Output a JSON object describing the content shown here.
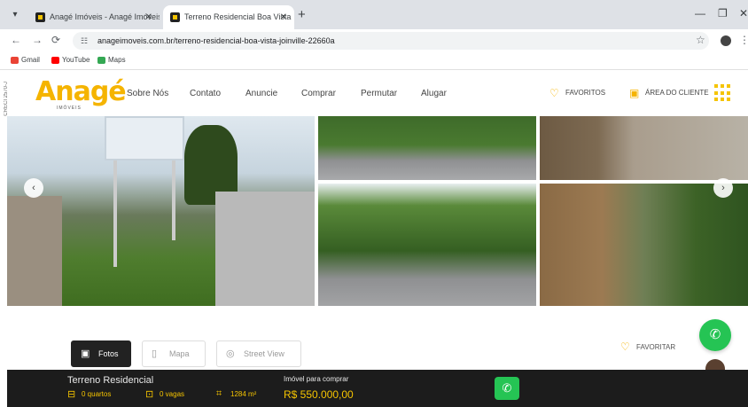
{
  "browser": {
    "tabs": [
      {
        "title": "Anagé Imóveis - Anagé Imóveis"
      },
      {
        "title": "Terreno Residencial Boa Vista"
      }
    ],
    "url": "anageimoveis.com.br/terreno-residencial-boa-vista-joinville-22660a",
    "bookmarks": [
      {
        "label": "Gmail",
        "color": "#ea4335"
      },
      {
        "label": "YouTube",
        "color": "#ff0000"
      },
      {
        "label": "Maps",
        "color": "#34a853"
      }
    ]
  },
  "header": {
    "side_label": "CRECI 2570-J",
    "logo": "Anagé",
    "logo_sub": "IMÓVEIS",
    "nav": [
      "Sobre Nós",
      "Contato",
      "Anuncie",
      "Comprar",
      "Permutar",
      "Alugar"
    ],
    "favorites_label": "FAVORITOS",
    "client_area_label": "ÁREA DO CLIENTE"
  },
  "view_tabs": [
    {
      "label": "Fotos",
      "icon": "camera-icon",
      "active": true
    },
    {
      "label": "Mapa",
      "icon": "map-icon",
      "active": false
    },
    {
      "label": "Street View",
      "icon": "street-view-icon",
      "active": false
    }
  ],
  "favoritar_label": "FAVORITAR",
  "listing": {
    "title": "Terreno Residencial",
    "bedrooms": "0 quartos",
    "parking": "0 vagas",
    "area": "1284 m²",
    "deal_label": "Imóvel para comprar",
    "price": "R$ 550.000,00"
  },
  "colors": {
    "accent": "#f5c400",
    "whatsapp": "#25c454",
    "bar": "#1c1c1c"
  }
}
